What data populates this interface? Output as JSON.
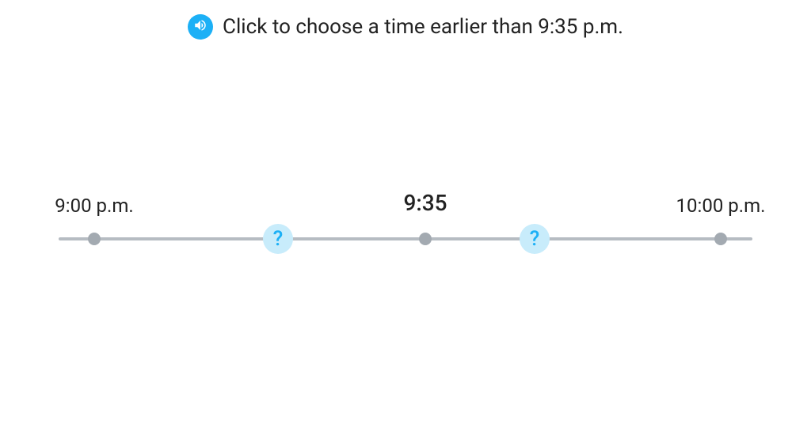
{
  "prompt": {
    "text": "Click to choose a time earlier than 9:35 p.m."
  },
  "timeline": {
    "startLabel": "9:00 p.m.",
    "referenceLabel": "9:35",
    "endLabel": "10:00 p.m.",
    "choiceGlyph": "?"
  },
  "colors": {
    "accent": "#1cb0f6",
    "choiceBg": "#c8ecfb",
    "axis": "#b6bcc2",
    "tick": "#a3aab1"
  }
}
